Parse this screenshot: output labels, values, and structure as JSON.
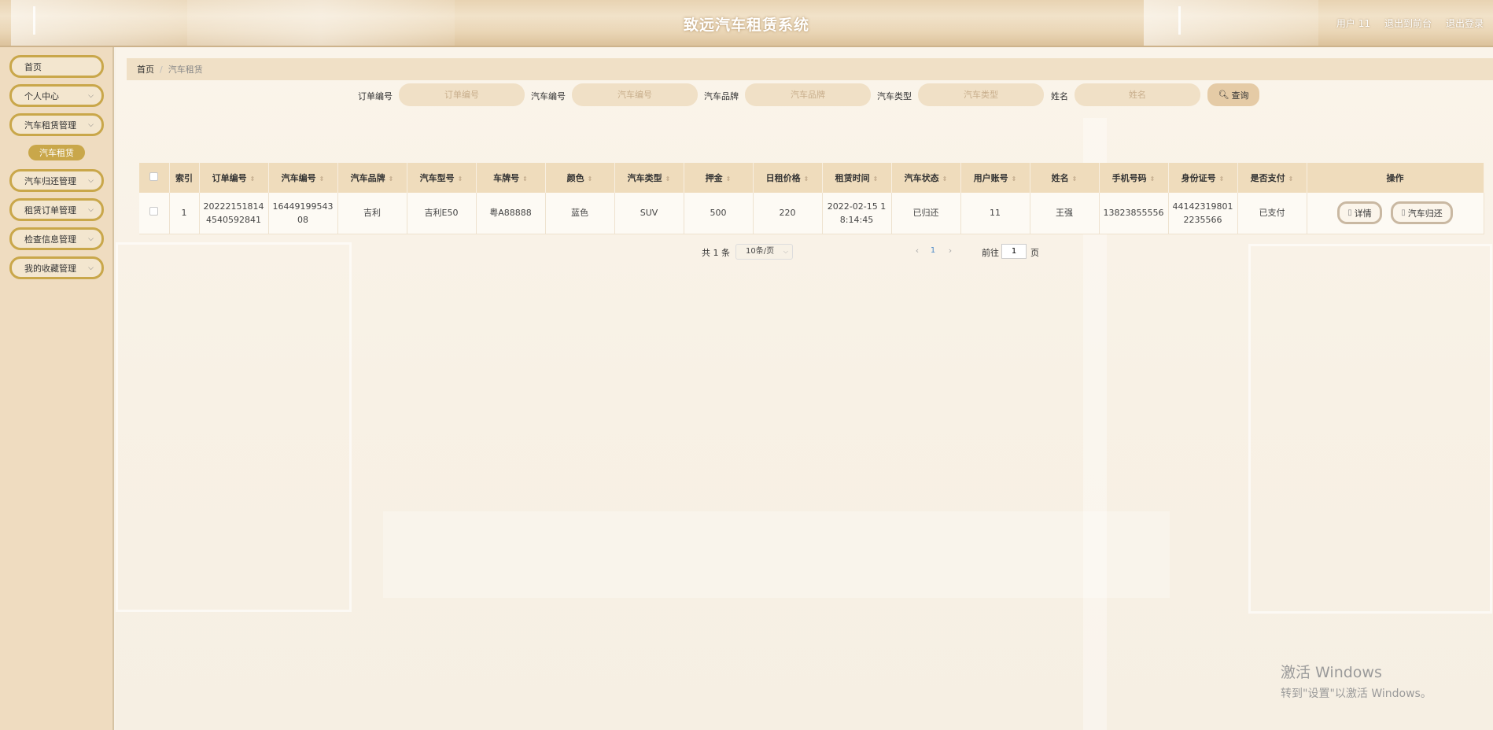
{
  "header": {
    "title": "致远汽车租赁系统",
    "user": "用户 11",
    "front_link": "退出到前台",
    "logout_link": "退出登录"
  },
  "sidebar": {
    "items": [
      {
        "label": "首页"
      },
      {
        "label": "个人中心"
      },
      {
        "label": "汽车租赁管理"
      },
      {
        "label": "汽车归还管理"
      },
      {
        "label": "租赁订单管理"
      },
      {
        "label": "检查信息管理"
      },
      {
        "label": "我的收藏管理"
      }
    ],
    "active_sub": "汽车租赁"
  },
  "breadcrumb": {
    "home": "首页",
    "separator": "/",
    "current": "汽车租赁"
  },
  "search": {
    "fields": [
      {
        "label": "订单编号",
        "placeholder": "订单编号"
      },
      {
        "label": "汽车编号",
        "placeholder": "汽车编号"
      },
      {
        "label": "汽车品牌",
        "placeholder": "汽车品牌"
      },
      {
        "label": "汽车类型",
        "placeholder": "汽车类型"
      },
      {
        "label": "姓名",
        "placeholder": "姓名"
      }
    ],
    "button": "查询"
  },
  "table": {
    "columns": [
      "索引",
      "订单编号",
      "汽车编号",
      "汽车品牌",
      "汽车型号",
      "车牌号",
      "颜色",
      "汽车类型",
      "押金",
      "日租价格",
      "租赁时间",
      "汽车状态",
      "用户账号",
      "姓名",
      "手机号码",
      "身份证号",
      "是否支付",
      "操作"
    ],
    "rows": [
      {
        "cells": [
          "1",
          "202221518144540592841",
          "1644919954308",
          "吉利",
          "吉利E50",
          "粤A88888",
          "蓝色",
          "SUV",
          "500",
          "220",
          "2022-02-15 18:14:45",
          "已归还",
          "11",
          "王强",
          "13823855556",
          "441423198012235566",
          "已支付"
        ],
        "actions": [
          "详情",
          "汽车归还"
        ]
      }
    ]
  },
  "pagination": {
    "total": "共 1 条",
    "page_size": "10条/页",
    "current_page": "1",
    "goto_label": "前往",
    "goto_value": "1",
    "goto_unit": "页"
  },
  "watermark": {
    "line1": "激活 Windows",
    "line2": "转到\"设置\"以激活 Windows。"
  }
}
